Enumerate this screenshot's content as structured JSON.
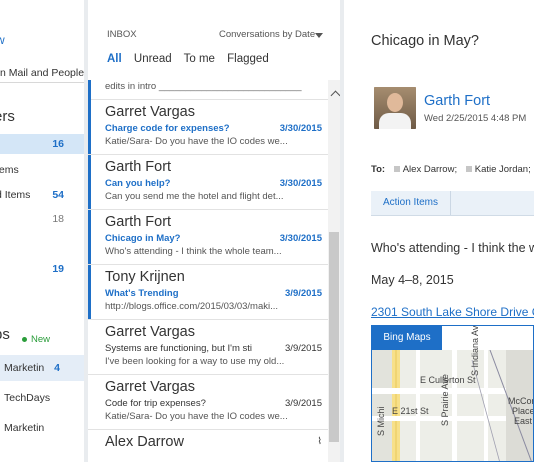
{
  "nav": {
    "new_link": "w",
    "search_text": "n Mail and People",
    "folders_heading": "ers",
    "folders": [
      {
        "label": "",
        "count": "16",
        "selected": true
      },
      {
        "label": "tems",
        "count": ""
      },
      {
        "label": "d Items",
        "count": "54"
      },
      {
        "label": "",
        "count": "18"
      },
      {
        "label": "",
        "count": "19"
      }
    ],
    "groups_heading": "ps",
    "new_badge": "New",
    "groups": [
      {
        "label": "Marketin",
        "count": "4"
      },
      {
        "label": "TechDays",
        "count": ""
      },
      {
        "label": "Marketin",
        "count": ""
      }
    ]
  },
  "list": {
    "inbox_label": "INBOX",
    "sort_label": "Conversations by Date",
    "filters": [
      "All",
      "Unread",
      "To me",
      "Flagged"
    ],
    "first_preview": "edits in intro ___________________________",
    "messages": [
      {
        "from": "Garret Vargas",
        "subject": "Charge code for expenses?",
        "date": "3/30/2015",
        "preview": "Katie/Sara- Do you have the IO codes we...",
        "unread": true
      },
      {
        "from": "Garth Fort",
        "subject": "Can you help?",
        "date": "3/30/2015",
        "preview": "Can you send me the hotel and flight det...",
        "unread": true
      },
      {
        "from": "Garth Fort",
        "subject": "Chicago in May?",
        "date": "3/30/2015",
        "preview": "Who's attending - I think the whole team...",
        "unread": true
      },
      {
        "from": "Tony Krijnen",
        "subject": "What's Trending",
        "date": "3/9/2015",
        "preview": "http://blogs.office.com/2015/03/03/maki...",
        "unread": true
      },
      {
        "from": "Garret Vargas",
        "subject": "Systems are functioning, but I'm sti",
        "date": "3/9/2015",
        "preview": "I've been looking for a way to use my old...",
        "unread": false
      },
      {
        "from": "Garret Vargas",
        "subject": "Code for trip expenses?",
        "date": "3/9/2015",
        "preview": "Katie/Sara- Do you have the IO codes we...",
        "unread": false
      },
      {
        "from": "Alex Darrow",
        "subject": "",
        "date": "",
        "preview": "",
        "unread": false
      }
    ]
  },
  "reading": {
    "subject": "Chicago in May?",
    "sender": "Garth Fort",
    "sent": "Wed 2/25/2015 4:48 PM",
    "to_label": "To:",
    "recipients": [
      "Alex Darrow;",
      "Katie Jordan;"
    ],
    "action_items": "Action Items",
    "body_line1": "Who's attending - I think the w",
    "body_line2": "May 4–8, 2015",
    "address": "2301 South Lake Shore Drive C",
    "map_tab": "Bing Maps",
    "map_labels": {
      "s_mich": "S Michi",
      "cullerton": "E Cullerton St",
      "e21": "E 21st St",
      "prairie": "S Prairie Ave",
      "indiana": "S Indiana Ave",
      "mccorm1": "McCorm",
      "mccorm2": "Place",
      "mccorm3": "East"
    }
  }
}
